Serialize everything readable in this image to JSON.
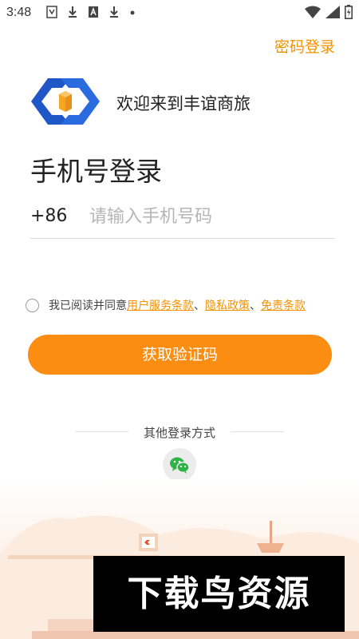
{
  "status_bar": {
    "time": "3:48"
  },
  "header": {
    "password_login": "密码登录"
  },
  "brand": {
    "welcome": "欢迎来到丰谊商旅"
  },
  "login": {
    "title": "手机号登录",
    "country_code": "+86",
    "phone_placeholder": "请输入手机号码",
    "phone_value": ""
  },
  "agreement": {
    "prefix": "我已阅读并同意",
    "user_terms": "用户服务条款",
    "sep1": "、",
    "privacy": "隐私政策",
    "sep2": "、",
    "disclaimer": "免责条款"
  },
  "actions": {
    "get_code": "获取验证码"
  },
  "other_login": {
    "label": "其他登录方式",
    "methods": [
      "wechat-icon"
    ]
  },
  "watermark": {
    "text": "下载鸟资源"
  },
  "colors": {
    "accent": "#f39200",
    "button": "#fa8d12",
    "logo_blue": "#1f56c8",
    "logo_orange": "#f5a623"
  }
}
